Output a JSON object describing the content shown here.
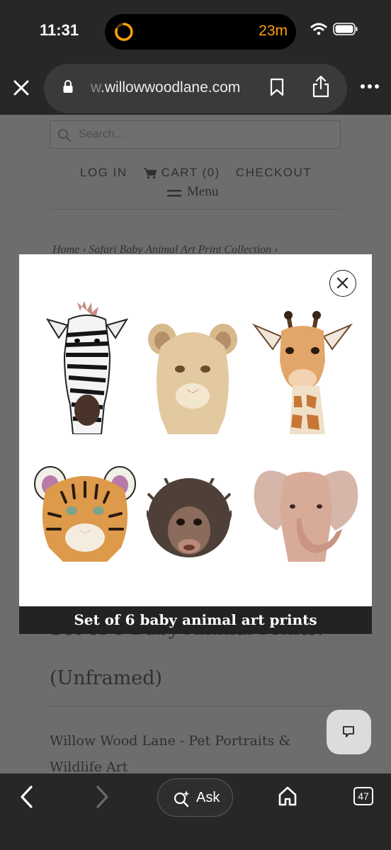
{
  "status_bar": {
    "time": "11:31",
    "timer": "23m"
  },
  "browser": {
    "url_prefix": "w",
    "url_domain": ".willowwoodlane.com"
  },
  "page": {
    "search_placeholder": "Search...",
    "nav": {
      "login": "LOG IN",
      "cart": "CART (0)",
      "checkout": "CHECKOUT"
    },
    "menu_label": "Menu",
    "breadcrumb": "Home  ›  Safari Baby Animal Art Print Collection  ›",
    "product_title": "Set of 6 Baby Animal Prints.",
    "product_subtitle": "(Unframed)",
    "vendor": "Willow Wood Lane - Pet Portraits & Wildlife Art"
  },
  "lightbox": {
    "caption": "Set of 6 baby animal art prints",
    "images": [
      "zebra",
      "lion-cub",
      "giraffe",
      "tiger-cub",
      "chimpanzee",
      "elephant"
    ]
  },
  "toolbar": {
    "ask_label": "Ask",
    "tab_count": "47"
  }
}
